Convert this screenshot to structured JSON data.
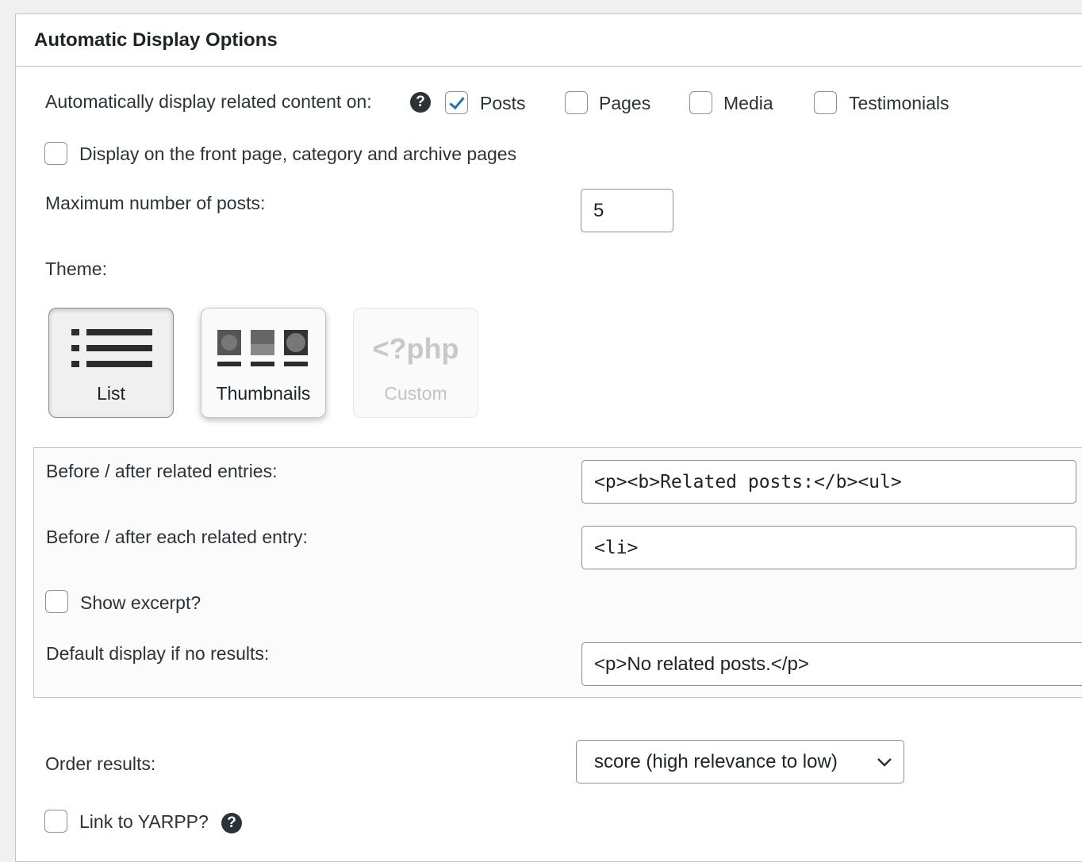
{
  "title": "Automatic Display Options",
  "display_on": {
    "label": "Automatically display related content on:",
    "help_icon": "question-circle-icon",
    "options": [
      {
        "label": "Posts",
        "checked": true
      },
      {
        "label": "Pages",
        "checked": false
      },
      {
        "label": "Media",
        "checked": false
      },
      {
        "label": "Testimonials",
        "checked": false
      }
    ]
  },
  "front_page": {
    "label": "Display on the front page, category and archive pages",
    "checked": false
  },
  "max_posts": {
    "label": "Maximum number of posts:",
    "value": "5"
  },
  "theme": {
    "label": "Theme:",
    "options": [
      {
        "label": "List",
        "icon": "list-icon",
        "selected": true
      },
      {
        "label": "Thumbnails",
        "icon": "thumbnails-icon",
        "selected": false
      },
      {
        "label": "Custom",
        "icon": "php-icon",
        "icon_text": "<?php",
        "disabled": true
      }
    ]
  },
  "before_after_entries": {
    "label": "Before / after related entries:",
    "value": "<p><b>Related posts:</b><ul>"
  },
  "before_after_each": {
    "label": "Before / after each related entry:",
    "value": "<li>"
  },
  "show_excerpt": {
    "label": "Show excerpt?",
    "checked": false
  },
  "no_results": {
    "label": "Default display if no results:",
    "value": "<p>No related posts.</p>"
  },
  "order": {
    "label": "Order results:",
    "value": "score (high relevance to low)"
  },
  "link_yarpp": {
    "label": "Link to YARPP?",
    "checked": false
  }
}
